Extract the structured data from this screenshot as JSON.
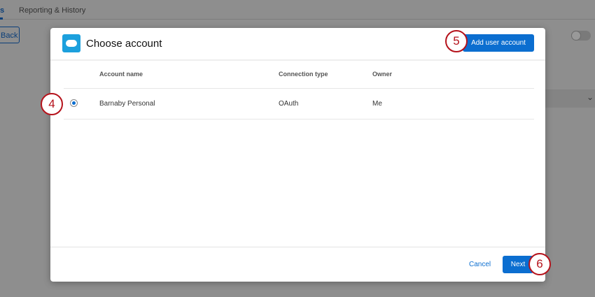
{
  "background": {
    "tab_active": "s",
    "tab_reporting": "Reporting & History",
    "back_label": "Back"
  },
  "modal": {
    "title": "Choose account",
    "add_button": "Add user account",
    "columns": [
      "Account name",
      "Connection type",
      "Owner"
    ],
    "rows": [
      {
        "account_name": "Barnaby Personal",
        "connection_type": "OAuth",
        "owner": "Me",
        "selected": true
      }
    ],
    "cancel": "Cancel",
    "next": "Next"
  },
  "callouts": [
    "4",
    "5",
    "6"
  ],
  "colors": {
    "primary": "#0b6ed0",
    "callout": "#b5121b",
    "salesforce": "#1ca0dd"
  }
}
